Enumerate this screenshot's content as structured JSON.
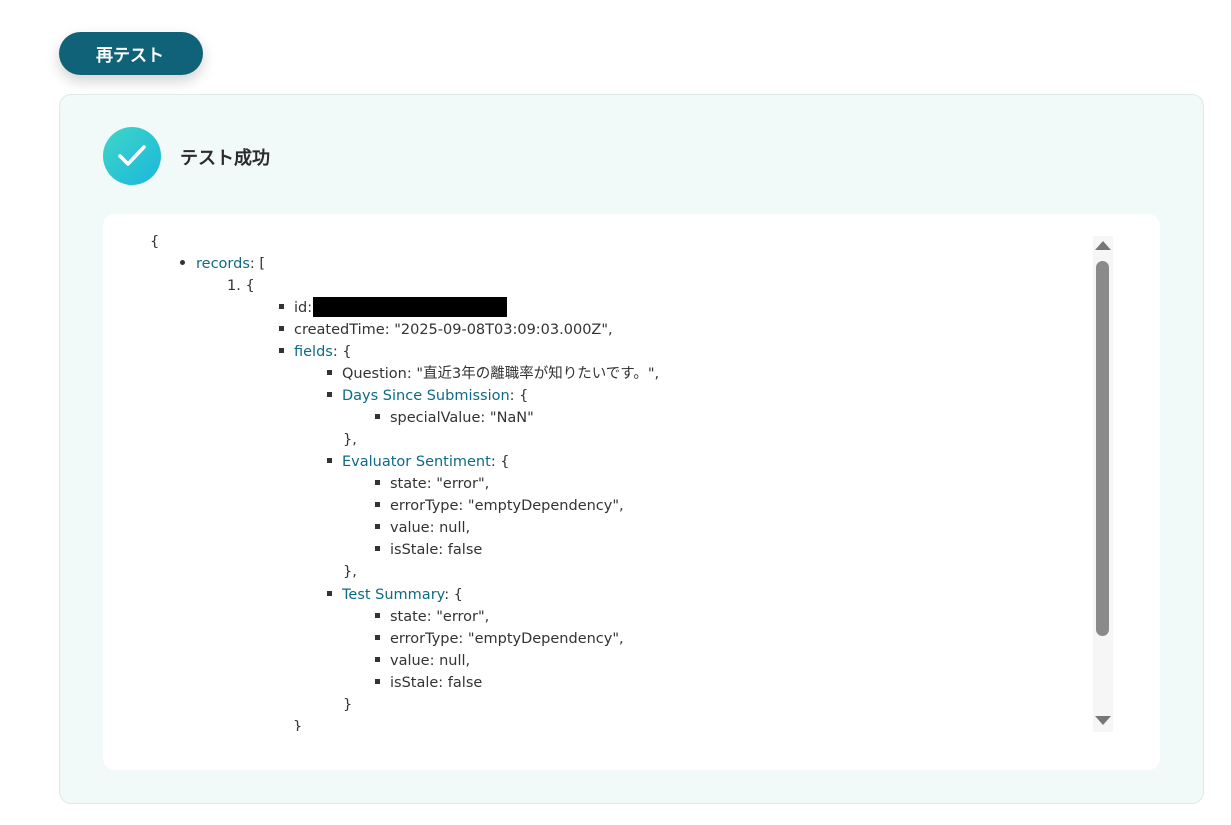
{
  "retest_label": "再テスト",
  "status": {
    "title": "テスト成功",
    "icon": "check-icon"
  },
  "json_lines": {
    "open_brace": "{",
    "records_key": "records",
    "records_open": ": [",
    "item_index": "1. {",
    "id_key": "id:",
    "created_time": "createdTime: \"2025-09-08T03:09:03.000Z\",",
    "fields_key": "fields",
    "fields_open": ": {",
    "question": "Question: \"直近3年の離職率が知りたいです。\",",
    "days_key": "Days Since Submission",
    "days_open": ": {",
    "special_value": "specialValue: \"NaN\"",
    "close_comma": "},",
    "sentiment_key": "Evaluator Sentiment",
    "sentiment_open": ": {",
    "state_error": "state: \"error\",",
    "error_type": "errorType: \"emptyDependency\",",
    "value_null": "value: null,",
    "is_stale": "isStale: false",
    "close_comma_2": "},",
    "summary_key": "Test Summary",
    "summary_open": ": {",
    "state_error_2": "state: \"error\",",
    "error_type_2": "errorType: \"emptyDependency\",",
    "value_null_2": "value: null,",
    "is_stale_2": "isStale: false",
    "close_brace": "}",
    "close_brace_outer": "}"
  },
  "colors": {
    "button": "#0f6277",
    "panel_bg": "#f2f9f9",
    "key_link": "#0e6a86",
    "check_gradient_start": "#3fd6c8",
    "check_gradient_end": "#1ab7dc"
  }
}
